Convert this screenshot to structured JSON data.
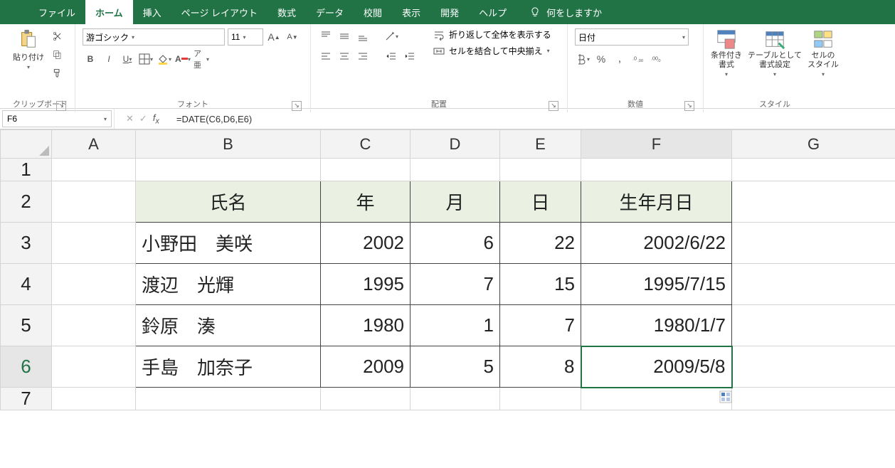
{
  "tabs": {
    "file": "ファイル",
    "home": "ホーム",
    "insert": "挿入",
    "pagelayout": "ページ レイアウト",
    "formulas": "数式",
    "data": "データ",
    "review": "校閲",
    "view": "表示",
    "developer": "開発",
    "help": "ヘルプ",
    "tellme": "何をしますか"
  },
  "ribbon": {
    "clipboard": {
      "paste": "貼り付け",
      "label": "クリップボード"
    },
    "font": {
      "name": "游ゴシック",
      "size": "11",
      "label": "フォント",
      "bold": "B",
      "italic": "I",
      "underline": "U"
    },
    "alignment": {
      "wrap": "折り返して全体を表示する",
      "merge": "セルを結合して中央揃え",
      "label": "配置"
    },
    "number": {
      "format": "日付",
      "label": "数値"
    },
    "styles": {
      "cond": "条件付き\n書式",
      "table": "テーブルとして\n書式設定",
      "cell": "セルの\nスタイル",
      "label": "スタイル"
    }
  },
  "namebox": "F6",
  "formula": "=DATE(C6,D6,E6)",
  "columns": [
    "A",
    "B",
    "C",
    "D",
    "E",
    "F",
    "G"
  ],
  "rowlabels": [
    "1",
    "2",
    "3",
    "4",
    "5",
    "6",
    "7"
  ],
  "headers": {
    "B": "氏名",
    "C": "年",
    "D": "月",
    "E": "日",
    "F": "生年月日"
  },
  "rows": [
    {
      "B": "小野田　美咲",
      "C": "2002",
      "D": "6",
      "E": "22",
      "F": "2002/6/22"
    },
    {
      "B": "渡辺　光輝",
      "C": "1995",
      "D": "7",
      "E": "15",
      "F": "1995/7/15"
    },
    {
      "B": "鈴原　湊",
      "C": "1980",
      "D": "1",
      "E": "7",
      "F": "1980/1/7"
    },
    {
      "B": "手島　加奈子",
      "C": "2009",
      "D": "5",
      "E": "8",
      "F": "2009/5/8"
    }
  ]
}
